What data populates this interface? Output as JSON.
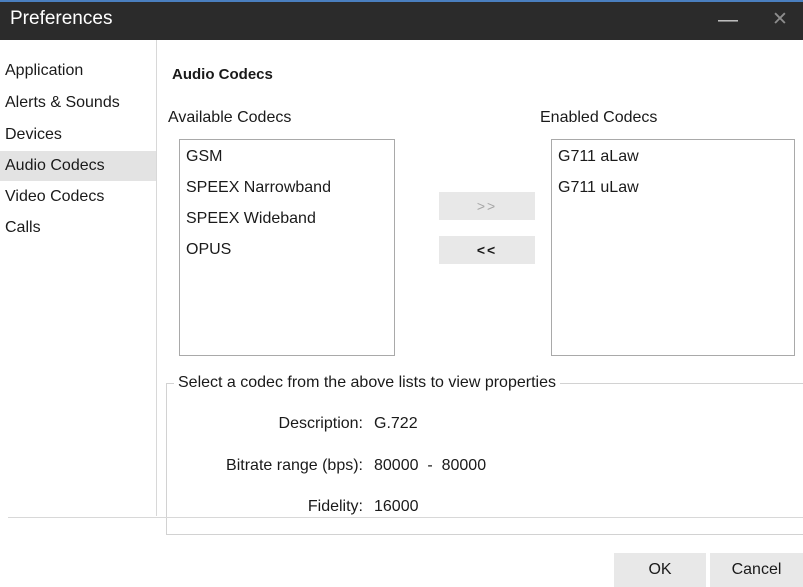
{
  "window": {
    "title": "Preferences",
    "minimize_glyph": "—",
    "close_glyph": "✕"
  },
  "sidebar": {
    "items": [
      {
        "label": "Application"
      },
      {
        "label": "Alerts & Sounds"
      },
      {
        "label": "Devices"
      },
      {
        "label": "Audio Codecs",
        "selected": true
      },
      {
        "label": "Video Codecs"
      },
      {
        "label": "Calls"
      }
    ]
  },
  "main": {
    "section_title": "Audio Codecs",
    "available_label": "Available Codecs",
    "enabled_label": "Enabled Codecs",
    "available_codecs": [
      "GSM",
      "SPEEX Narrowband",
      "SPEEX Wideband",
      "OPUS"
    ],
    "enabled_codecs": [
      "G711 aLaw",
      "G711 uLaw"
    ],
    "add_button": ">>",
    "remove_button": "<<"
  },
  "properties": {
    "legend": "Select a codec from the above lists to view properties",
    "description_label": "Description:",
    "description_value": "G.722",
    "bitrate_label": "Bitrate range (bps):",
    "bitrate_value": "80000  -  80000",
    "fidelity_label": "Fidelity:",
    "fidelity_value": "16000"
  },
  "footer": {
    "ok_label": "OK",
    "cancel_label": "Cancel"
  }
}
